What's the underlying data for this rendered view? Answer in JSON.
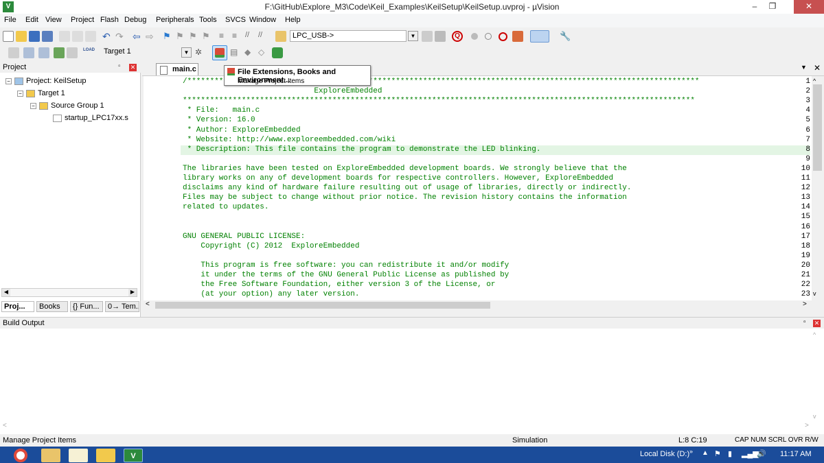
{
  "window": {
    "title": "F:\\GitHub\\Explore_M3\\Code\\Keil_Examples\\KeilSetup\\KeilSetup.uvproj - µVision",
    "app_icon": "V"
  },
  "menu": [
    "File",
    "Edit",
    "View",
    "Project",
    "Flash",
    "Debug",
    "Peripherals",
    "Tools",
    "SVCS",
    "Window",
    "Help"
  ],
  "toolbar1": {
    "target_combo": "LPC_USB->"
  },
  "toolbar2": {
    "load_label": "LOAD",
    "target_select": "Target 1"
  },
  "tooltip": {
    "title": "File Extensions, Books and Environment...",
    "sub": "Manage Project Items"
  },
  "project_panel": {
    "title": "Project",
    "tree": [
      {
        "label": "Project: KeilSetup",
        "level": 0,
        "toggle": "−"
      },
      {
        "label": "Target 1",
        "level": 1,
        "toggle": "−"
      },
      {
        "label": "Source Group 1",
        "level": 2,
        "toggle": "−"
      },
      {
        "label": "startup_LPC17xx.s",
        "level": 3,
        "toggle": ""
      }
    ],
    "bottom_tabs": [
      "Proj...",
      "Books",
      "{} Fun...",
      "0→ Tem..."
    ]
  },
  "editor": {
    "tab": "main.c",
    "lines": [
      "/*****************************************************************************************************************",
      "                             ExploreEmbedded",
      "*****************************************************************************************************************",
      " * File:   main.c",
      " * Version: 16.0",
      " * Author: ExploreEmbedded",
      " * Website: http://www.exploreembedded.com/wiki",
      " * Description: This file contains the program to demonstrate the LED blinking.",
      "",
      "The libraries have been tested on ExploreEmbedded development boards. We strongly believe that the",
      "library works on any of development boards for respective controllers. However, ExploreEmbedded",
      "disclaims any kind of hardware failure resulting out of usage of libraries, directly or indirectly.",
      "Files may be subject to change without prior notice. The revision history contains the information",
      "related to updates.",
      "",
      "",
      "GNU GENERAL PUBLIC LICENSE:",
      "    Copyright (C) 2012  ExploreEmbedded",
      "",
      "    This program is free software: you can redistribute it and/or modify",
      "    it under the terms of the GNU General Public License as published by",
      "    the Free Software Foundation, either version 3 of the License, or",
      "    (at your option) any later version."
    ]
  },
  "build_output": {
    "title": "Build Output"
  },
  "status": {
    "hint": "Manage Project Items",
    "mode": "Simulation",
    "pos": "L:8 C:19",
    "keys": "CAP  NUM  SCRL  OVR  R/W"
  },
  "taskbar": {
    "tray_label": "Local Disk (D:)",
    "chevron": "»",
    "clock": "11:17 AM"
  },
  "colors": {
    "comment": "#008000",
    "title_bg": "#ffffff",
    "taskbar": "#1b4c9a",
    "current_line": "#e3f5e4"
  }
}
